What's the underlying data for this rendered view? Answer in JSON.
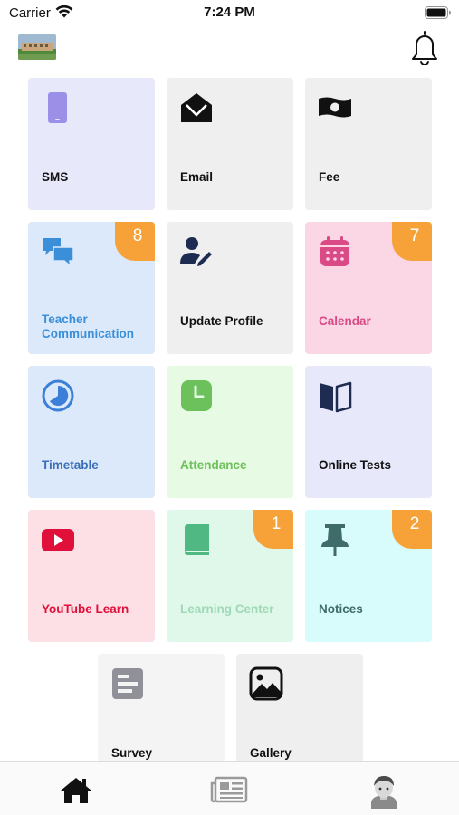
{
  "status_bar": {
    "carrier": "Carrier",
    "time": "7:24 PM"
  },
  "header": {
    "logo_icon": "school-building-photo",
    "bell_icon": "bell-icon"
  },
  "tiles": [
    {
      "label": "SMS",
      "icon": "phone-icon",
      "bg": "#e8e8fb",
      "label_color": "#111111"
    },
    {
      "label": "Email",
      "icon": "envelope-open-icon",
      "bg": "#efefef",
      "label_color": "#111111"
    },
    {
      "label": "Fee",
      "icon": "money-bill-icon",
      "bg": "#efefef",
      "label_color": "#111111"
    },
    {
      "label": "Teacher Communication",
      "icon": "chat-icon",
      "bg": "#dce9fb",
      "label_color": "#3a8fd8",
      "badge": "8"
    },
    {
      "label": "Update Profile",
      "icon": "user-edit-icon",
      "bg": "#efefef",
      "label_color": "#111111"
    },
    {
      "label": "Calendar",
      "icon": "calendar-icon",
      "bg": "#fbd7e6",
      "label_color": "#d94a86",
      "badge": "7"
    },
    {
      "label": "Timetable",
      "icon": "clock-pie-icon",
      "bg": "#dce9fb",
      "label_color": "#3a6fb8"
    },
    {
      "label": "Attendance",
      "icon": "clock-icon",
      "bg": "#e7fae3",
      "label_color": "#6cc15c"
    },
    {
      "label": "Online Tests",
      "icon": "book-open-icon",
      "bg": "#e8e8fb",
      "label_color": "#111111"
    },
    {
      "label": "YouTube Learn",
      "icon": "youtube-icon",
      "bg": "#fde0e6",
      "label_color": "#e0103a"
    },
    {
      "label": "Learning Center",
      "icon": "book-icon",
      "bg": "#dff8ea",
      "label_color": "#9fd9b6",
      "badge": "1"
    },
    {
      "label": "Notices",
      "icon": "pushpin-icon",
      "bg": "#d8fbfb",
      "label_color": "#3f6b6b",
      "badge": "2"
    },
    {
      "label": "Survey",
      "icon": "poll-icon",
      "bg": "#f4f4f4",
      "label_color": "#111111"
    },
    {
      "label": "Gallery",
      "icon": "image-icon",
      "bg": "#efefef",
      "label_color": "#111111"
    }
  ],
  "nav": [
    {
      "name": "home",
      "icon": "home-icon"
    },
    {
      "name": "news",
      "icon": "newspaper-icon"
    },
    {
      "name": "profile",
      "icon": "avatar-icon"
    }
  ],
  "colors": {
    "badge": "#f7a238",
    "accent_blue": "#3a8fd8",
    "calendar_pink": "#d94a86",
    "youtube_red": "#e0103a"
  }
}
